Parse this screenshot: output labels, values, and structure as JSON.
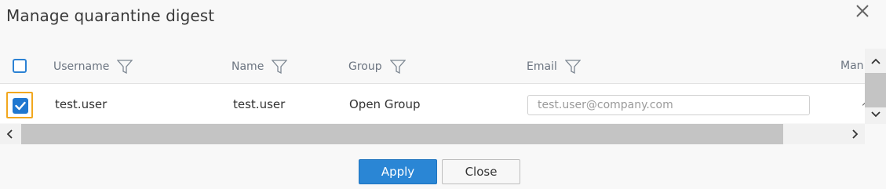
{
  "dialog": {
    "title": "Manage quarantine digest",
    "close_icon": "close-icon"
  },
  "table": {
    "columns": [
      {
        "label": "Username",
        "icon": "filter-icon"
      },
      {
        "label": "Name",
        "icon": "filter-icon"
      },
      {
        "label": "Group",
        "icon": "filter-icon"
      },
      {
        "label": "Email",
        "icon": "filter-icon"
      },
      {
        "label": "Man"
      }
    ],
    "header_checkbox_checked": false,
    "rows": [
      {
        "selected": true,
        "username": "test.user",
        "name": "test.user",
        "group": "Open Group",
        "email_placeholder": "test.user@company.com"
      }
    ]
  },
  "buttons": {
    "apply": "Apply",
    "close": "Close"
  },
  "colors": {
    "accent": "#2a86d5",
    "focus_outline": "#f2a71e"
  }
}
